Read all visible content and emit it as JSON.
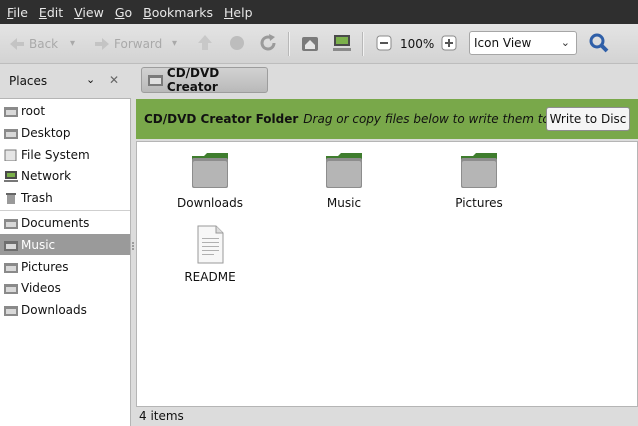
{
  "menu": {
    "items": [
      "File",
      "Edit",
      "View",
      "Go",
      "Bookmarks",
      "Help"
    ]
  },
  "toolbar": {
    "back_label": "Back",
    "forward_label": "Forward",
    "zoom_value": "100%",
    "view_mode": "Icon View",
    "icons": [
      "arrow-left-icon",
      "arrow-right-icon",
      "arrow-up-icon",
      "stop-icon",
      "reload-icon",
      "home-icon",
      "computer-icon",
      "zoom-out-icon",
      "zoom-in-icon",
      "search-icon"
    ]
  },
  "sidebar": {
    "title": "Places",
    "items": [
      {
        "label": "root",
        "icon": "home-folder-icon"
      },
      {
        "label": "Desktop",
        "icon": "folder-icon"
      },
      {
        "label": "File System",
        "icon": "drive-icon"
      },
      {
        "label": "Network",
        "icon": "network-icon"
      },
      {
        "label": "Trash",
        "icon": "trash-icon"
      },
      {
        "label": "Documents",
        "icon": "folder-icon"
      },
      {
        "label": "Music",
        "icon": "folder-icon"
      },
      {
        "label": "Pictures",
        "icon": "folder-icon"
      },
      {
        "label": "Videos",
        "icon": "folder-icon"
      },
      {
        "label": "Downloads",
        "icon": "folder-icon"
      }
    ],
    "active": "Music"
  },
  "location": {
    "crumb": "CD/DVD Creator"
  },
  "infobar": {
    "title": "CD/DVD Creator Folder",
    "description": "Drag or copy files below to write them to d...",
    "button": "Write to Disc"
  },
  "files": [
    {
      "name": "Downloads",
      "type": "folder"
    },
    {
      "name": "Music",
      "type": "folder"
    },
    {
      "name": "Pictures",
      "type": "folder"
    },
    {
      "name": "README",
      "type": "document"
    }
  ],
  "status": {
    "text": "4 items"
  },
  "colors": {
    "accent": "#79a84a",
    "menubar": "#2f2f2f",
    "selected": "#9a9a9a"
  }
}
